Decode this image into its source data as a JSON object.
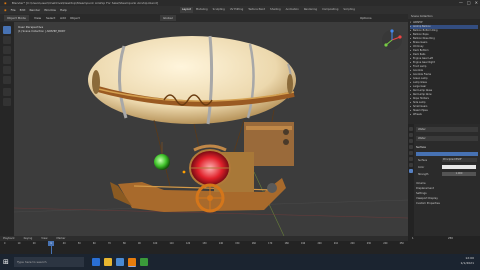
{
  "window": {
    "title": "Blender* [C:\\Users\\user\\OneDrive\\Desktop\\Steampunk Airship For Sale\\Steampunk Airship.blend]",
    "controls": [
      "—",
      "□",
      "✕"
    ]
  },
  "menu": {
    "items": [
      "File",
      "Edit",
      "Render",
      "Window",
      "Help"
    ]
  },
  "workspaces": {
    "tabs": [
      "Layout",
      "Modeling",
      "Sculpting",
      "UV Editing",
      "Texture Paint",
      "Shading",
      "Animation",
      "Rendering",
      "Compositing",
      "Scripting"
    ],
    "active": "Layout"
  },
  "viewport": {
    "overlay_line1": "User Perspective",
    "overlay_line2": "(1) Scene Collection | AIRSHIP_BODY",
    "mode": "Object Mode",
    "menus": [
      "View",
      "Select",
      "Add",
      "Object"
    ],
    "transform": "Global",
    "options": "Options"
  },
  "outliner": {
    "title": "Scene Collection",
    "rows": [
      "AIRSHIP",
      "Airship Balloon",
      "Balloon Bottom Ring",
      "Balloon Rope",
      "Balloon Nose Ring",
      "Brass Gears",
      "Chimney",
      "Deck Bottom",
      "Deck Rails",
      "Engine Gear Left",
      "Engine Gear Right",
      "Front Lamp",
      "Gondola",
      "Gondola Frame",
      "Green Lamp",
      "Lamp Glass",
      "Large Gear",
      "Red Lamp Glass",
      "Red Lamp Glow",
      "Rope Holders",
      "Side Lamp",
      "Small Gears",
      "Steam Pipes",
      "Wheels"
    ]
  },
  "properties": {
    "object_name": "Water",
    "section": "Surface",
    "surface_label": "Surface",
    "surface_value": "Principled BSDF",
    "settings": "Settings",
    "volume": "Volume",
    "displacement": "Displacement",
    "viewport_display": "Viewport Display",
    "custom_properties": "Custom Properties",
    "rows": [
      {
        "label": "Surface",
        "value": "Principled BSDF"
      },
      {
        "label": "Color",
        "value": ""
      },
      {
        "label": "Strength",
        "value": "1.000"
      }
    ]
  },
  "timeline": {
    "menus": [
      "Playback",
      "Keying",
      "View",
      "Marker"
    ],
    "frame_numbers": [
      "0",
      "10",
      "20",
      "30",
      "40",
      "50",
      "60",
      "70",
      "80",
      "90",
      "100",
      "110",
      "120",
      "130",
      "140",
      "150",
      "160",
      "170",
      "180",
      "190",
      "200",
      "210",
      "220",
      "230",
      "240",
      "250"
    ],
    "current_frame": "1",
    "start": "1",
    "end": "250"
  },
  "taskbar": {
    "search_placeholder": "Type here to search",
    "time": "12:00",
    "date": "1/1/2021"
  },
  "colors": {
    "accent": "#4772b3",
    "selected": "#334d80",
    "viewport_bg": "#3c3c3c",
    "balloon": "#f3e2bf",
    "brass": "#a86a2c"
  }
}
